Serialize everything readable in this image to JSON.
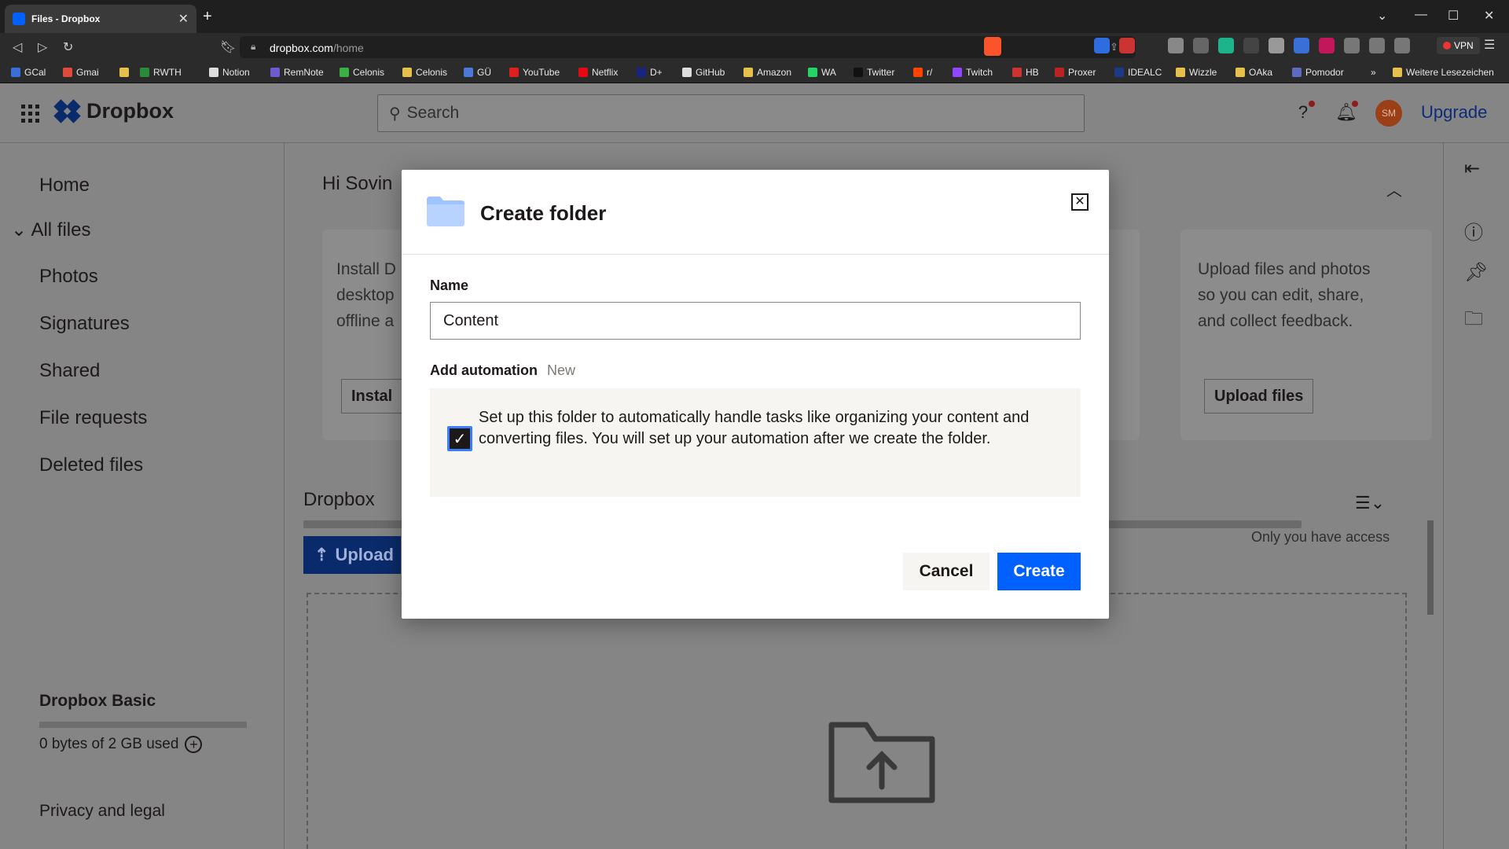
{
  "browser": {
    "tab_title": "Files - Dropbox",
    "url_domain": "dropbox.com",
    "url_path": "/home",
    "vpn_label": "VPN",
    "bookmarks": [
      "GCal",
      "Gmai",
      "RWTH",
      "Notion",
      "RemNote",
      "Celonis",
      "Celonis",
      "GÜ",
      "YouTube",
      "Netflix",
      "D+",
      "GitHub",
      "Amazon",
      "WA",
      "Twitter",
      "r/",
      "Twitch",
      "HB",
      "Proxer",
      "IDEALC",
      "Wizzle",
      "OAka",
      "Pomodor"
    ],
    "bookmarks_more": "»",
    "other_bookmarks": "Weitere Lesezeichen"
  },
  "app": {
    "logo_text": "Dropbox",
    "search_placeholder": "Search",
    "avatar_initials": "SM",
    "upgrade_label": "Upgrade"
  },
  "sidebar": {
    "home": "Home",
    "all_files": "All files",
    "photos": "Photos",
    "signatures": "Signatures",
    "shared": "Shared",
    "file_requests": "File requests",
    "deleted_files": "Deleted files",
    "plan": "Dropbox Basic",
    "usage": "0 bytes of 2 GB used",
    "privacy": "Privacy and legal"
  },
  "main": {
    "greeting": "Hi Sovin",
    "card1_lines": [
      "Install D",
      "desktop",
      "offline a"
    ],
    "card1_button": "Instal",
    "card3_lines": [
      "Upload files and photos",
      "so you can edit, share,",
      "and collect feedback."
    ],
    "card3_button": "Upload files",
    "section_title": "Dropbox",
    "upload_button": "Upload",
    "access_text": "Only you have access"
  },
  "modal": {
    "title": "Create folder",
    "name_label": "Name",
    "name_value": "Content",
    "automation_label": "Add automation",
    "automation_badge": "New",
    "automation_checked": true,
    "automation_text": "Set up this folder to automatically handle tasks like organizing your content and converting files. You will set up your automation after we create the folder.",
    "cancel_label": "Cancel",
    "create_label": "Create"
  },
  "colors": {
    "accent": "#0061fe",
    "checkbox_ring": "#3d7cff",
    "avatar": "#9b3f17"
  }
}
